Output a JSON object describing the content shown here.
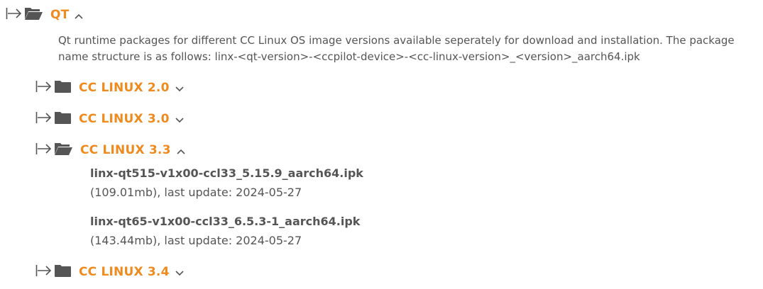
{
  "root": {
    "label": "QT",
    "expanded": true,
    "description": "Qt runtime packages for different CC Linux OS image versions available seperately for download and installation. The package name structure is as follows: linx-<qt-version>-<ccpilot-device>-<cc-linux-version>_<version>_aarch64.ipk"
  },
  "folders": [
    {
      "label": "CC LINUX 2.0",
      "expanded": false
    },
    {
      "label": "CC LINUX 3.0",
      "expanded": false
    },
    {
      "label": "CC LINUX 3.3",
      "expanded": true
    },
    {
      "label": "CC LINUX 3.4",
      "expanded": false
    }
  ],
  "files": [
    {
      "name": "linx-qt515-v1x00-ccl33_5.15.9_aarch64.ipk",
      "meta": "(109.01mb), last update: 2024-05-27"
    },
    {
      "name": "linx-qt65-v1x00-ccl33_6.5.3-1_aarch64.ipk",
      "meta": "(143.44mb), last update: 2024-05-27"
    }
  ],
  "colors": {
    "accent": "#ef8a1e",
    "icon": "#555555",
    "text": "#555555"
  },
  "icons": {
    "expand": "arrow-to-bar-icon",
    "folder_closed": "folder-icon",
    "folder_open": "folder-open-icon",
    "chevron_up": "chevron-up-icon",
    "chevron_down": "chevron-down-icon"
  }
}
